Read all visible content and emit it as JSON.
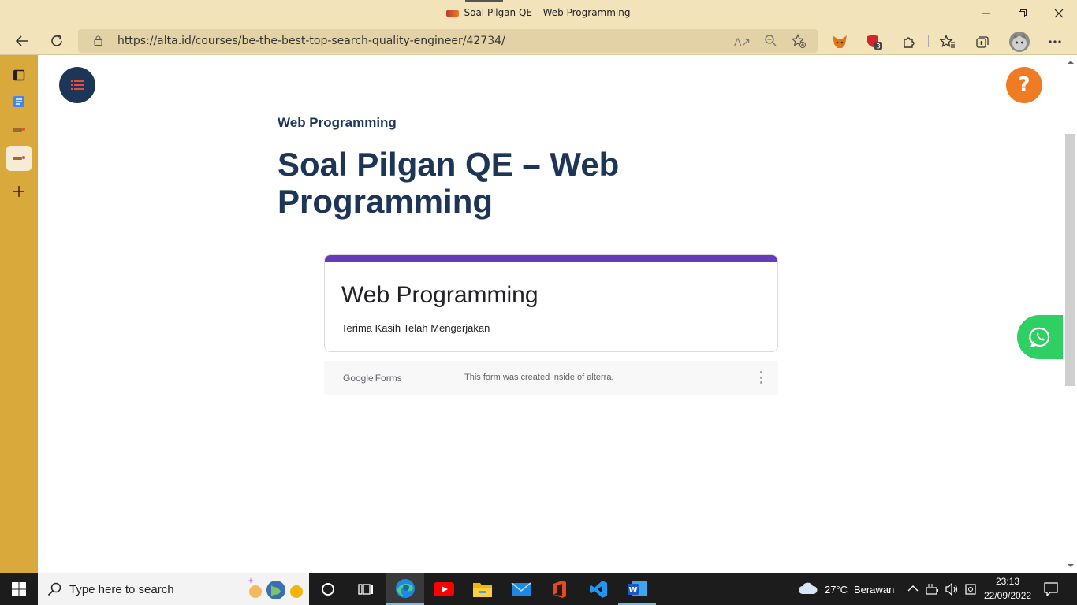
{
  "browser": {
    "window_title": "Soal Pilgan QE – Web Programming",
    "url": "https://alta.id/courses/be-the-best-top-search-quality-engineer/42734/",
    "extension_badge": "3"
  },
  "page": {
    "breadcrumb": "Web Programming",
    "title": "Soal Pilgan QE – Web Programming",
    "help_label": "?"
  },
  "form": {
    "title": "Web Programming",
    "description": "Terima Kasih Telah Mengerjakan",
    "brand_google": "Google",
    "brand_forms": "Forms",
    "note": "This form was created inside of alterra.",
    "accent_color": "#673ab7"
  },
  "taskbar": {
    "search_placeholder": "Type here to search",
    "weather_temp": "27°C",
    "weather_desc": "Berawan",
    "time": "23:13",
    "date": "22/09/2022"
  },
  "colors": {
    "browser_chrome": "#f2e3bb",
    "sidebar": "#d9aa3b",
    "brand_navy": "#1d3557",
    "help_orange": "#ef7c22",
    "whatsapp_green": "#2ed063"
  }
}
